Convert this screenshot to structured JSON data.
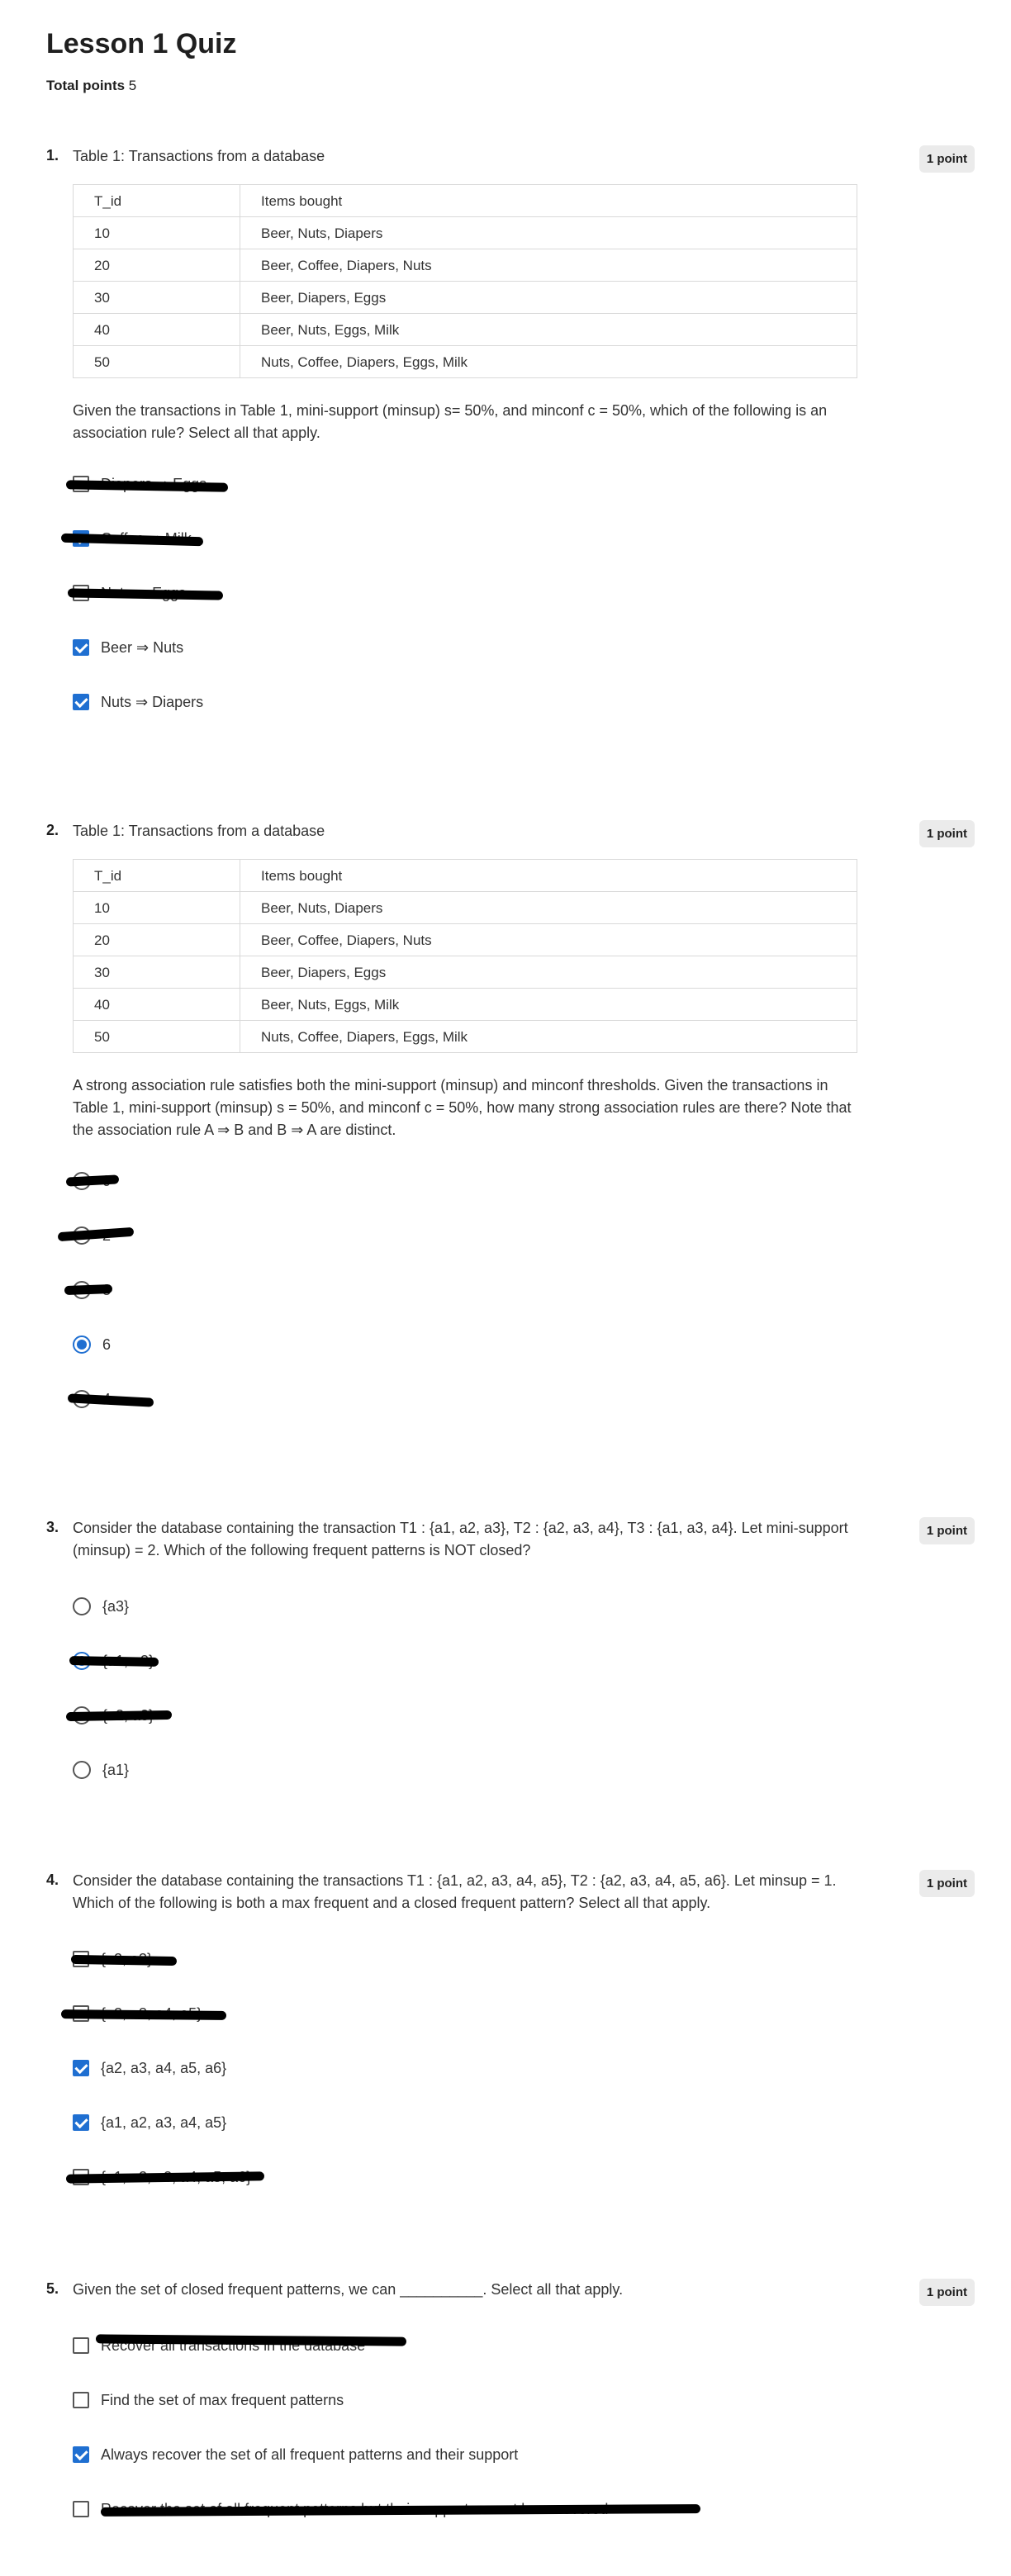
{
  "title": "Lesson 1 Quiz",
  "total_points_label": "Total points",
  "total_points_value": "5",
  "table": {
    "caption": "Table 1: Transactions from a database",
    "headers": [
      "T_id",
      "Items bought"
    ],
    "rows": [
      [
        "10",
        "Beer, Nuts, Diapers"
      ],
      [
        "20",
        "Beer, Coffee, Diapers, Nuts"
      ],
      [
        "30",
        "Beer, Diapers, Eggs"
      ],
      [
        "40",
        "Beer, Nuts, Eggs, Milk"
      ],
      [
        "50",
        "Nuts, Coffee, Diapers, Eggs, Milk"
      ]
    ]
  },
  "questions": [
    {
      "number": "1.",
      "points": "1 point",
      "text": "Given the transactions in Table 1, mini-support (minsup) s= 50%, and minconf c = 50%, which of the following is an association rule? Select all that apply.",
      "options": [
        {
          "label": "Diapers ⇒ Eggs",
          "selected": false,
          "redacted": true
        },
        {
          "label": "Coffee ⇒ Milk",
          "selected": true,
          "redacted": true
        },
        {
          "label": "Nuts ⇒ Eggs",
          "selected": false,
          "redacted": true
        },
        {
          "label": "Beer ⇒ Nuts",
          "selected": true,
          "redacted": false
        },
        {
          "label": "Nuts ⇒ Diapers",
          "selected": true,
          "redacted": false
        }
      ]
    },
    {
      "number": "2.",
      "points": "1 point",
      "text": "A strong association rule satisfies both the mini-support (minsup) and minconf thresholds. Given the transactions in Table 1, mini-support (minsup) s = 50%, and minconf c = 50%, how many strong association rules are there? Note that the association rule A ⇒ B and B ⇒ A are distinct.",
      "options": [
        {
          "label": "0",
          "selected": false,
          "redacted": true
        },
        {
          "label": "2",
          "selected": false,
          "redacted": true
        },
        {
          "label": "8",
          "selected": false,
          "redacted": true
        },
        {
          "label": "6",
          "selected": true,
          "redacted": false
        },
        {
          "label": "4",
          "selected": false,
          "redacted": true
        }
      ]
    },
    {
      "number": "3.",
      "points": "1 point",
      "text": "Consider the database containing the transaction T1 : {a1, a2, a3}, T2 : {a2, a3, a4}, T3 : {a1, a3, a4}. Let mini-support (minsup) = 2. Which of the following frequent patterns is NOT closed?",
      "options": [
        {
          "label": "{a3}",
          "selected": false,
          "redacted": false
        },
        {
          "label": "{a1, a3}",
          "selected": true,
          "redacted": true
        },
        {
          "label": "{a2, a3}",
          "selected": false,
          "redacted": true
        },
        {
          "label": "{a1}",
          "selected": false,
          "redacted": false
        }
      ]
    },
    {
      "number": "4.",
      "points": "1 point",
      "text": "Consider the database containing the transactions T1 : {a1, a2, a3, a4, a5}, T2 : {a2, a3, a4, a5, a6}. Let minsup = 1. Which of the following is both a max frequent and a closed frequent pattern? Select all that apply.",
      "options": [
        {
          "label": "{a2, a3}",
          "selected": false,
          "redacted": true
        },
        {
          "label": "{a2, a3, a4, a5}",
          "selected": false,
          "redacted": true
        },
        {
          "label": "{a2, a3, a4, a5, a6}",
          "selected": true,
          "redacted": false
        },
        {
          "label": "{a1, a2, a3, a4, a5}",
          "selected": true,
          "redacted": false
        },
        {
          "label": "{a1, a2, a3, a4, a5, a6}",
          "selected": false,
          "redacted": true
        }
      ]
    },
    {
      "number": "5.",
      "points": "1 point",
      "text": "Given the set of closed frequent patterns, we can __________. Select all that apply.",
      "options": [
        {
          "label": "Recover all transactions in the database",
          "selected": false,
          "redacted": true
        },
        {
          "label": "Find the set of max frequent patterns",
          "selected": false,
          "redacted": false
        },
        {
          "label": "Always recover the set of all frequent patterns and their support",
          "selected": true,
          "redacted": false
        },
        {
          "label": "Recover the set of all frequent patterns but their support cannot be recovered",
          "selected": false,
          "redacted": true
        }
      ]
    }
  ],
  "colors": {
    "accent": "#1f6fd1",
    "badge_bg": "#ebebeb",
    "redaction": "#000000"
  },
  "icons": {
    "checkbox": "checkbox-icon",
    "radio": "radio-icon"
  }
}
